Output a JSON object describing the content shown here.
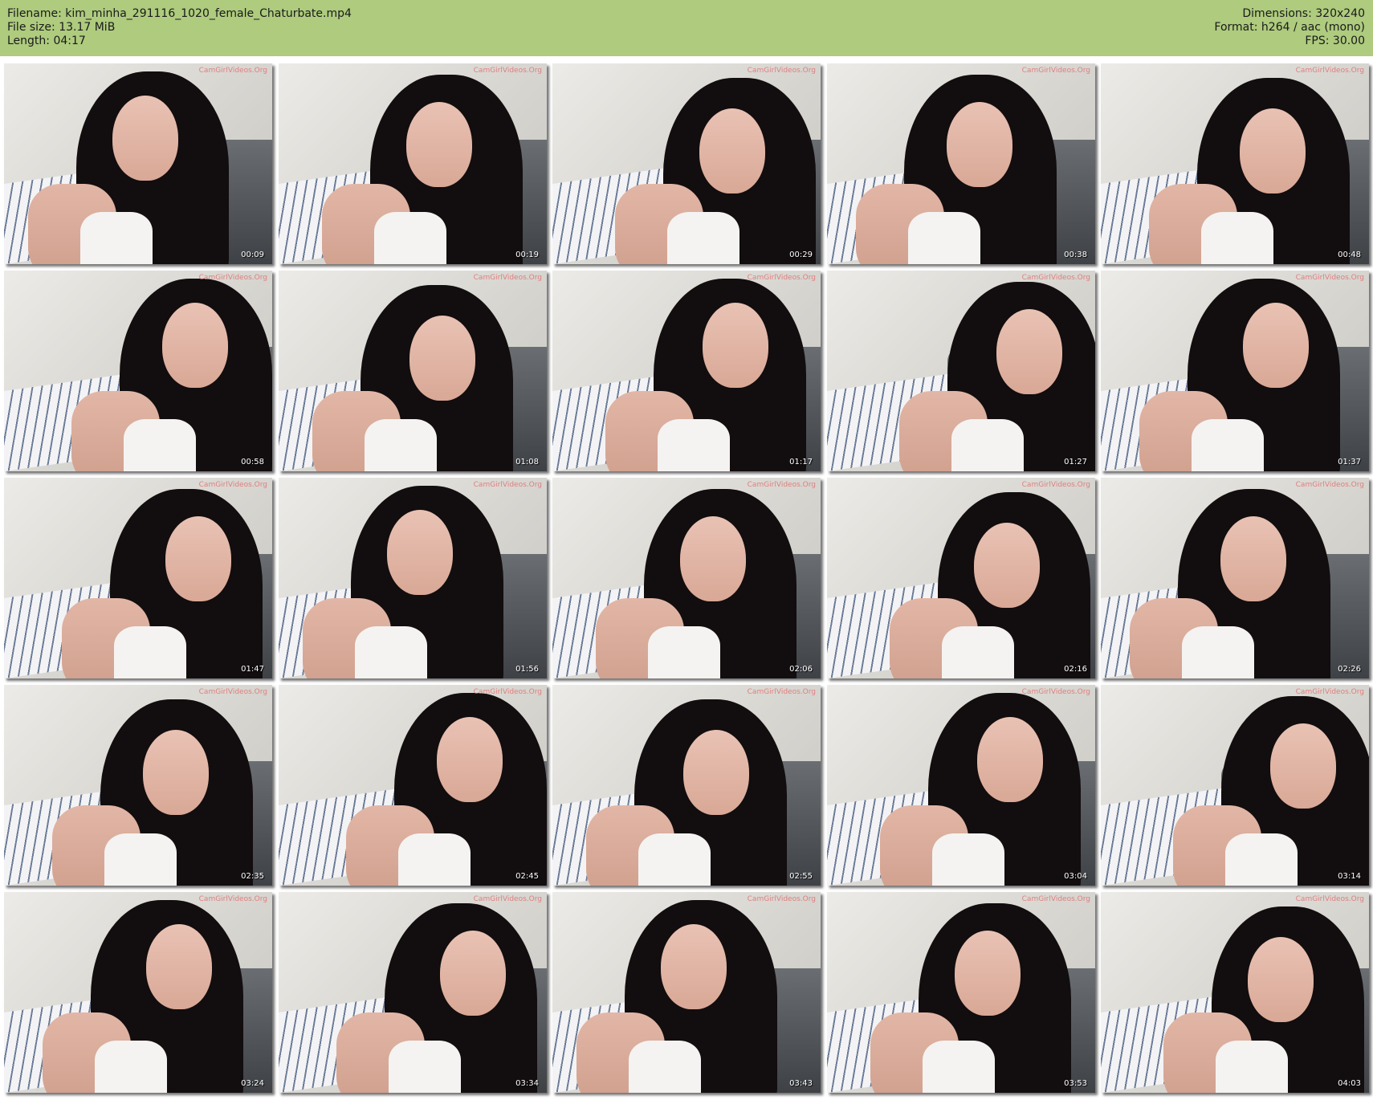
{
  "header": {
    "filename_line": "Filename: kim_minha_291116_1020_female_Chaturbate.mp4",
    "filesize_line": "File size: 13.17 MiB",
    "length_line": "Length: 04:17",
    "dimensions_line": "Dimensions: 320x240",
    "format_line": "Format: h264 / aac (mono)",
    "fps_line": "FPS: 30.00",
    "background_color": "#aecb7e"
  },
  "watermark": "CamGirlVideos.Org",
  "thumbnails": [
    {
      "timestamp": "00:09"
    },
    {
      "timestamp": "00:19"
    },
    {
      "timestamp": "00:29"
    },
    {
      "timestamp": "00:38"
    },
    {
      "timestamp": "00:48"
    },
    {
      "timestamp": "00:58"
    },
    {
      "timestamp": "01:08"
    },
    {
      "timestamp": "01:17"
    },
    {
      "timestamp": "01:27"
    },
    {
      "timestamp": "01:37"
    },
    {
      "timestamp": "01:47"
    },
    {
      "timestamp": "01:56"
    },
    {
      "timestamp": "02:06"
    },
    {
      "timestamp": "02:16"
    },
    {
      "timestamp": "02:26"
    },
    {
      "timestamp": "02:35"
    },
    {
      "timestamp": "02:45"
    },
    {
      "timestamp": "02:55"
    },
    {
      "timestamp": "03:04"
    },
    {
      "timestamp": "03:14"
    },
    {
      "timestamp": "03:24"
    },
    {
      "timestamp": "03:34"
    },
    {
      "timestamp": "03:43"
    },
    {
      "timestamp": "03:53"
    },
    {
      "timestamp": "04:03"
    }
  ]
}
